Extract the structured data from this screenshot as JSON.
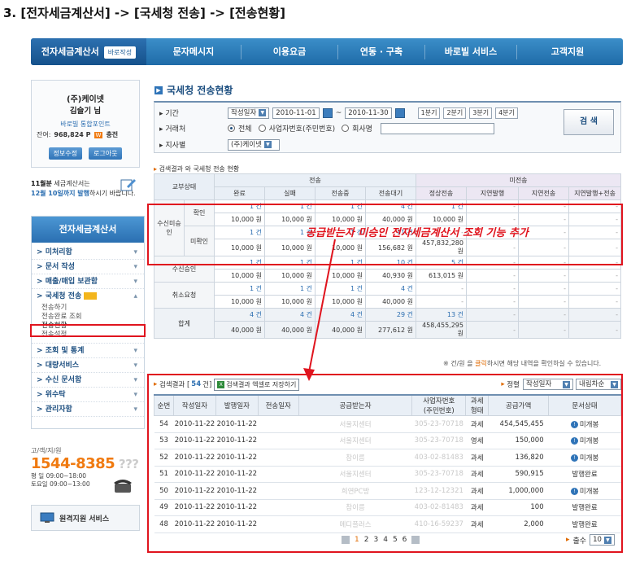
{
  "heading": "3. [전자세금계산서] -> [국세청 전송] -> [전송현황]",
  "topnav": {
    "items": [
      "전자세금계산서",
      "문자메시지",
      "이용요금",
      "연동 · 구축",
      "바로빌 서비스",
      "고객지원"
    ],
    "badge": "바로작성"
  },
  "user": {
    "company": "(주)케이넷",
    "name": "김슬기 님",
    "point_link": "바로빌 통합포인트",
    "balance_label": "잔여:",
    "balance": "968,824 P",
    "charge": "충전",
    "charge_w": "W",
    "edit_btn": "정보수정",
    "logout_btn": "로그아웃"
  },
  "notice": {
    "line1_em": "11월분",
    "line1": " 세금계산서는",
    "line2_em": "12월 10일까지 발행",
    "line2": "하시기 바랍니다."
  },
  "sidemenu": {
    "title": "전자세금계산서",
    "items": [
      {
        "label": "미처리함"
      },
      {
        "label": "문서 작성"
      },
      {
        "label": "매출/매입 보관함"
      },
      {
        "label": "국세청 전송",
        "sub": [
          "전송하기",
          "전송완료 조회",
          "전송현황",
          "전송설정"
        ]
      },
      {
        "label": "조회 및 통계"
      },
      {
        "label": "대량서비스"
      },
      {
        "label": "수신 문서함"
      },
      {
        "label": "위수탁"
      },
      {
        "label": "관리자함"
      }
    ]
  },
  "support": {
    "title": "고/객/지/원",
    "phone": "1544-8385",
    "hours1": "평  일 09:00~18:00",
    "hours2": "토요일 09:00~13:00",
    "remote": "원격지원 서비스"
  },
  "page_title": "국세청 전송현황",
  "search": {
    "period_label": "기간",
    "period_type": "작성일자",
    "date_from": "2010-11-01",
    "date_sep": "~",
    "date_to": "2010-11-30",
    "quarters": [
      "1분기",
      "2분기",
      "3분기",
      "4분기"
    ],
    "trader_label": "거래처",
    "radio_all": "전체",
    "radio_bizno": "사업자번호(주민번호)",
    "radio_company": "회사명",
    "branch_label": "지사별",
    "branch_value": "(주)케이넷",
    "button": "검 색"
  },
  "summary": {
    "label_prefix": "검색결과 ",
    "label_rest": "와 국세청 전송 현황",
    "col_status": "교부상태",
    "group_sent": "전송",
    "group_unsent": "미전송",
    "cols": [
      "완료",
      "실패",
      "전송중",
      "전송대기",
      "정상전송",
      "지연발행",
      "지연전송",
      "지연발행+전송"
    ],
    "g1": "수신미승인",
    "g1a": "확인",
    "g1b": "미확인",
    "g2": "수신승인",
    "g3": "취소요청",
    "g4": "합계",
    "rows": [
      {
        "c": [
          "1 건",
          "1 건",
          "1 건",
          "4 건",
          "1 건",
          "-",
          "-",
          "-"
        ],
        "w": [
          "10,000 원",
          "10,000 원",
          "10,000 원",
          "40,000 원",
          "10,000 원",
          "-",
          "-",
          "-"
        ]
      },
      {
        "c": [
          "1 건",
          "1 건",
          "1 건",
          "11 건",
          "-",
          "-",
          "-",
          "-"
        ],
        "w": [
          "10,000 원",
          "10,000 원",
          "10,000 원",
          "156,682 원",
          "457,832,280 원",
          "-",
          "-",
          "-"
        ]
      },
      {
        "c": [
          "1 건",
          "1 건",
          "1 건",
          "10 건",
          "5 건",
          "-",
          "-",
          "-"
        ],
        "w": [
          "10,000 원",
          "10,000 원",
          "10,000 원",
          "40,930 원",
          "613,015 원",
          "-",
          "-",
          "-"
        ]
      },
      {
        "c": [
          "1 건",
          "1 건",
          "1 건",
          "4 건",
          "-",
          "-",
          "-",
          "-"
        ],
        "w": [
          "10,000 원",
          "10,000 원",
          "10,000 원",
          "40,000 원",
          "-",
          "-",
          "-",
          "-"
        ]
      },
      {
        "c": [
          "4 건",
          "4 건",
          "4 건",
          "29 건",
          "13 건",
          "-",
          "-",
          "-"
        ],
        "w": [
          "40,000 원",
          "40,000 원",
          "40,000 원",
          "277,612 원",
          "458,455,295 원",
          "-",
          "-",
          "-"
        ]
      }
    ],
    "footnote_pre": "※ 건/원 을 ",
    "footnote_em": "클릭",
    "footnote_post": "하시면 해당 내역을 확인하실 수 있습니다."
  },
  "results": {
    "label": "검색결과 [",
    "count": "54",
    "count_suffix": "건]",
    "excel_btn": "검색결과 엑셀로 저장하기",
    "sort_label": "정렬",
    "sort_field": "작성일자",
    "sort_order": "내림차순",
    "headers": [
      "순번",
      "작성일자",
      "발행일자",
      "전송일자",
      "공급받는자",
      "사업자번호\n(주민번호)",
      "과세\n형태",
      "공급가액",
      "문서상태"
    ],
    "rows": [
      {
        "no": "54",
        "w": "2010-11-22",
        "p": "2010-11-22",
        "s": "",
        "name": "서울지센터",
        "biz": "305-23-70718",
        "tax": "과세",
        "amt": "454,545,455",
        "st": "미개봉",
        "icon": true
      },
      {
        "no": "53",
        "w": "2010-11-22",
        "p": "2010-11-22",
        "s": "",
        "name": "서울지센터",
        "biz": "305-23-70718",
        "tax": "영세",
        "amt": "150,000",
        "st": "미개봉",
        "icon": true
      },
      {
        "no": "52",
        "w": "2010-11-22",
        "p": "2010-11-22",
        "s": "",
        "name": "참이름",
        "biz": "403-02-81483",
        "tax": "과세",
        "amt": "136,820",
        "st": "미개봉",
        "icon": true
      },
      {
        "no": "51",
        "w": "2010-11-22",
        "p": "2010-11-22",
        "s": "",
        "name": "서울지센터",
        "biz": "305-23-70718",
        "tax": "과세",
        "amt": "590,915",
        "st": "발행완료",
        "icon": false
      },
      {
        "no": "50",
        "w": "2010-11-22",
        "p": "2010-11-22",
        "s": "",
        "name": "희연PC방",
        "biz": "123-12-12321",
        "tax": "과세",
        "amt": "1,000,000",
        "st": "미개봉",
        "icon": true
      },
      {
        "no": "49",
        "w": "2010-11-22",
        "p": "2010-11-22",
        "s": "",
        "name": "참이름",
        "biz": "403-02-81483",
        "tax": "과세",
        "amt": "100",
        "st": "발행완료",
        "icon": false
      },
      {
        "no": "48",
        "w": "2010-11-22",
        "p": "2010-11-22",
        "s": "",
        "name": "메디플러스",
        "biz": "410-16-59237",
        "tax": "과세",
        "amt": "2,000",
        "st": "발행완료",
        "icon": false
      }
    ],
    "pages": [
      "1",
      "2",
      "3",
      "4",
      "5",
      "6"
    ],
    "pagesize_label": "출수",
    "pagesize": "10"
  },
  "annotation": "공급받는자 미승인 전자세금계산서 조회 기능 추가",
  "colors": {
    "accent": "#2f74b8",
    "annotation": "#e0141e",
    "orange": "#f07a10"
  }
}
